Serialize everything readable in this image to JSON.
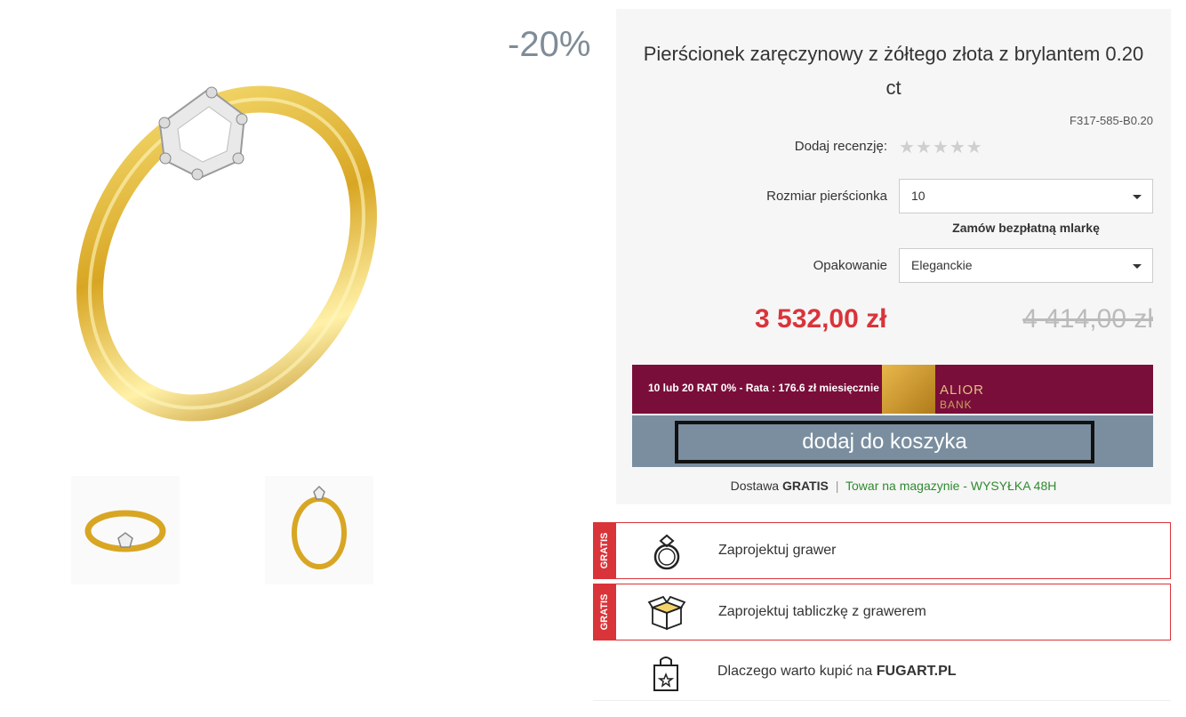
{
  "discount": "-20%",
  "product": {
    "title": "Pierścionek zaręczynowy z żółtego złota z brylantem 0.20 ct",
    "sku": "F317-585-B0.20"
  },
  "review": {
    "label": "Dodaj recenzję:",
    "stars": 5
  },
  "size": {
    "label": "Rozmiar pierścionka",
    "value": "10"
  },
  "sizer_link": "Zamów bezpłatną mlarkę",
  "packaging": {
    "label": "Opakowanie",
    "value": "Eleganckie"
  },
  "price": {
    "current": "3 532,00 zł",
    "old": "4 414,00 zł"
  },
  "installments": {
    "text": "10 lub 20 RAT 0% - Rata : 176.6 zł miesięcznie",
    "brand": "ALIOR",
    "brand_sub": "BANK"
  },
  "cart_button": "dodaj do koszyka",
  "delivery": {
    "prefix": "Dostawa",
    "gratis": "GRATIS",
    "separator": "|",
    "stock": "Towar na magazynie - WYSYŁKA 48H"
  },
  "features": [
    {
      "badge": "GRATIS",
      "icon": "ring-icon",
      "text": "Zaprojektuj grawer"
    },
    {
      "badge": "GRATIS",
      "icon": "gift-box-icon",
      "text": "Zaprojektuj tabliczkę z grawerem"
    },
    {
      "icon": "shopping-bag-icon",
      "text_prefix": "Dlaczego warto kupić na",
      "text_brand": "FUGART.PL"
    }
  ],
  "colors": {
    "price_red": "#d9343a",
    "cart_button_bg": "#7a8e9f",
    "alior_bg": "#7a0e3a",
    "discount_grey": "#7f8c98",
    "stock_green": "#2f8a2f"
  }
}
